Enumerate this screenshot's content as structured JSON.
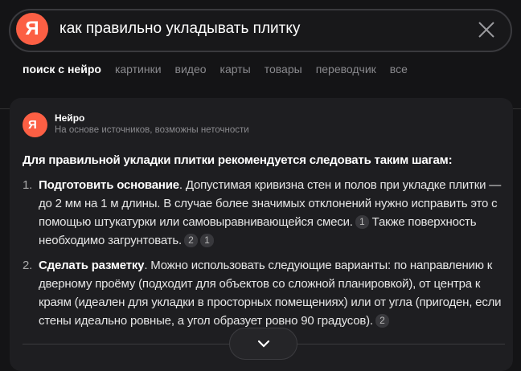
{
  "search": {
    "logo": "Я",
    "query": "как правильно укладывать плитку",
    "clear_icon": "close-icon"
  },
  "tabs": [
    "поиск с нейро",
    "картинки",
    "видео",
    "карты",
    "товары",
    "переводчик",
    "все"
  ],
  "neiro": {
    "title": "Нейро",
    "subtitle": "На основе источников, возможны неточности"
  },
  "answer": {
    "heading": "Для правильной укладки плитки рекомендуется следовать таким шагам:",
    "items": [
      {
        "num": "1.",
        "title": "Подготовить основание",
        "text1": ". Допустимая кривизна стен и полов при укладке плитки — до 2 мм на 1 м длины. В случае более значимых отклонений нужно исправить это с помощью штукатурки или самовыравнивающейся смеси.",
        "refs1": [
          "1"
        ],
        "text2": " Также поверхность необходимо загрунтовать.",
        "refs2": [
          "2",
          "1"
        ]
      },
      {
        "num": "2.",
        "title": "Сделать разметку",
        "text1": ". Можно использовать следующие варианты: по направлению к дверному проёму (подходит для объектов со сложной планировкой), от центра к краям (идеален для укладки в просторных помещениях) или от угла (пригоден, если стены идеально ровные, а угол образует ровно 90 градусов).",
        "refs1": [
          "2"
        ]
      }
    ]
  },
  "expand_icon": "chevron-down-icon"
}
